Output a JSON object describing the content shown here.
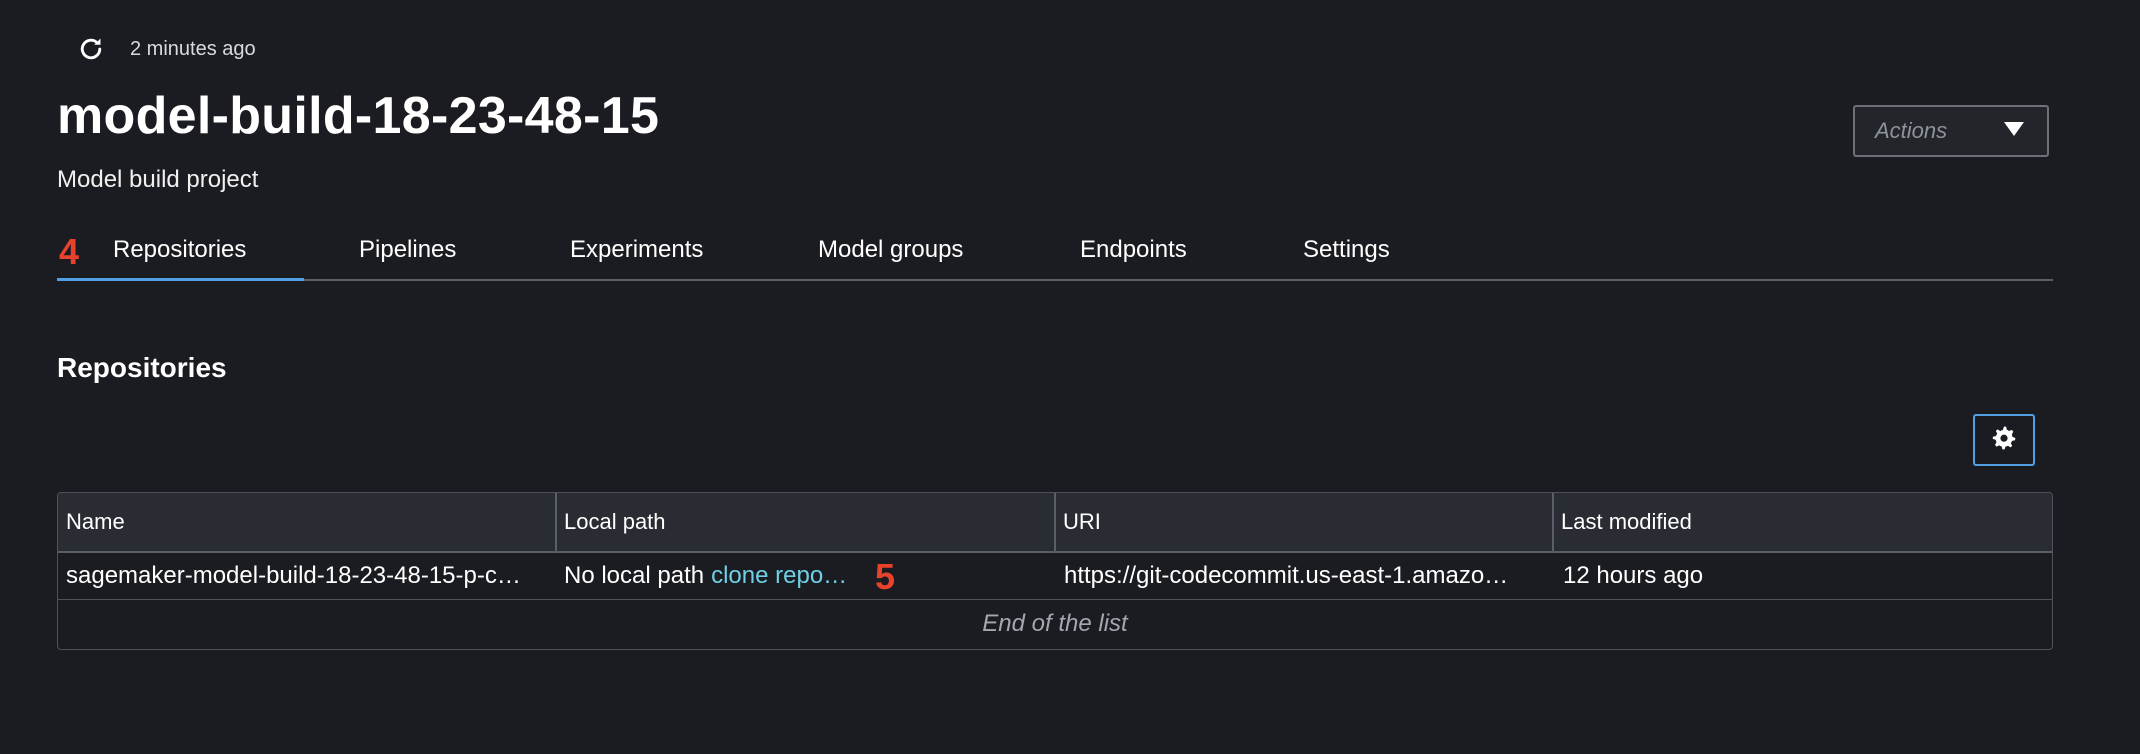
{
  "header": {
    "refresh_time": "2 minutes ago",
    "title": "model-build-18-23-48-15",
    "subtitle": "Model build project",
    "actions_label": "Actions"
  },
  "tabs": [
    {
      "label": "Repositories",
      "active": true
    },
    {
      "label": "Pipelines",
      "active": false
    },
    {
      "label": "Experiments",
      "active": false
    },
    {
      "label": "Model groups",
      "active": false
    },
    {
      "label": "Endpoints",
      "active": false
    },
    {
      "label": "Settings",
      "active": false
    }
  ],
  "annotations": {
    "marker_tabs": "4",
    "marker_clone": "5"
  },
  "repositories": {
    "section_title": "Repositories",
    "columns": [
      "Name",
      "Local path",
      "URI",
      "Last modified"
    ],
    "rows": [
      {
        "name": "sagemaker-model-build-18-23-48-15-p-c…",
        "local_path_text": "No local path",
        "local_path_link": "clone repo…",
        "uri": "https://git-codecommit.us-east-1.amazo…",
        "last_modified": "12 hours ago"
      }
    ],
    "end_of_list": "End of the list"
  },
  "icons": {
    "refresh": "refresh-icon",
    "actions_caret": "caret-down-icon",
    "settings": "gear-icon"
  },
  "colors": {
    "background": "#1b1c21",
    "accent_blue": "#539fe5",
    "link": "#6ecfe5",
    "marker_red": "#e8412c"
  }
}
